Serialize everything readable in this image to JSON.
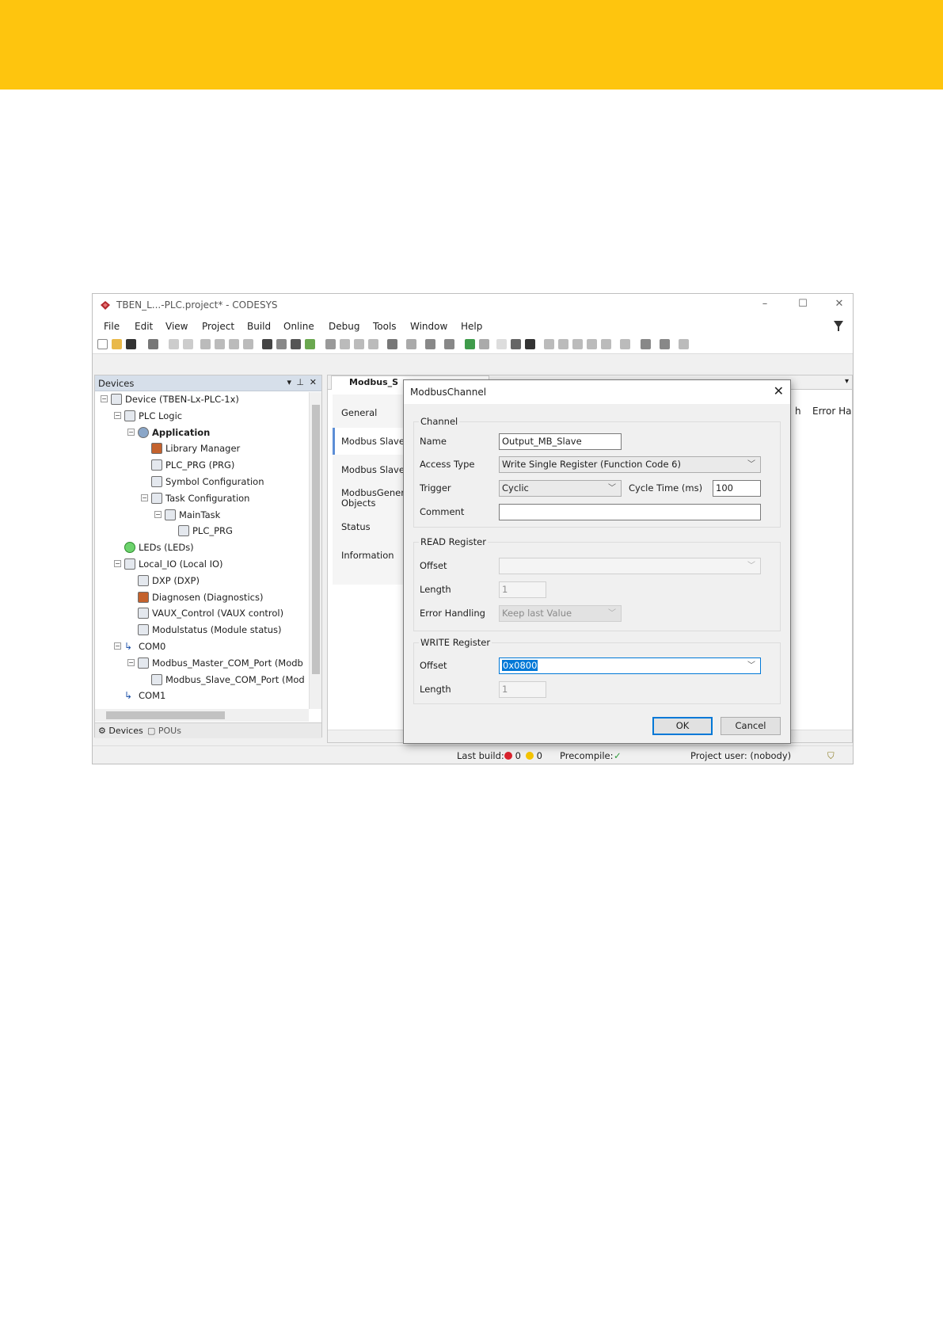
{
  "window": {
    "title": "TBEN_L...-PLC.project* - CODESYS"
  },
  "menu": [
    "File",
    "Edit",
    "View",
    "Project",
    "Build",
    "Online",
    "Debug",
    "Tools",
    "Window",
    "Help"
  ],
  "devices_panel": {
    "title": "Devices",
    "tree": [
      {
        "label": "Device (TBEN-Lx-PLC-1x)",
        "level": 0,
        "expand": "-"
      },
      {
        "label": "PLC Logic",
        "level": 1,
        "expand": "-"
      },
      {
        "label": "Application",
        "level": 2,
        "expand": "-",
        "bold": true
      },
      {
        "label": "Library Manager",
        "level": 3,
        "expand": ""
      },
      {
        "label": "PLC_PRG (PRG)",
        "level": 3,
        "expand": ""
      },
      {
        "label": "Symbol Configuration",
        "level": 3,
        "expand": ""
      },
      {
        "label": "Task Configuration",
        "level": 3,
        "expand": "-"
      },
      {
        "label": "MainTask",
        "level": 4,
        "expand": "-"
      },
      {
        "label": "PLC_PRG",
        "level": 5,
        "expand": ""
      },
      {
        "label": "LEDs (LEDs)",
        "level": 1,
        "expand": ""
      },
      {
        "label": "Local_IO (Local IO)",
        "level": 1,
        "expand": "-"
      },
      {
        "label": "DXP (DXP)",
        "level": 2,
        "expand": ""
      },
      {
        "label": "Diagnosen (Diagnostics)",
        "level": 2,
        "expand": ""
      },
      {
        "label": "VAUX_Control (VAUX control)",
        "level": 2,
        "expand": ""
      },
      {
        "label": "Modulstatus (Module status)",
        "level": 2,
        "expand": ""
      },
      {
        "label": "COM0",
        "level": 1,
        "expand": "-"
      },
      {
        "label": "Modbus_Master_COM_Port (Modb",
        "level": 2,
        "expand": "-"
      },
      {
        "label": "Modbus_Slave_COM_Port (Mod",
        "level": 3,
        "expand": ""
      },
      {
        "label": "COM1",
        "level": 1,
        "expand": ""
      }
    ],
    "tabs": [
      "Devices",
      "POUs"
    ]
  },
  "editor": {
    "tab_title": "Modbus_S",
    "side_tabs": [
      "General",
      "Modbus Slave C",
      "Modbus Slave I",
      "ModbusGeneric Objects",
      "Status",
      "Information"
    ],
    "right_col_1": "h",
    "right_col_2": "Error Ha"
  },
  "dialog": {
    "title": "ModbusChannel",
    "channel": {
      "group_label": "Channel",
      "name_label": "Name",
      "name_value": "Output_MB_Slave",
      "access_type_label": "Access Type",
      "access_type_value": "Write Single Register (Function Code 6)",
      "trigger_label": "Trigger",
      "trigger_value": "Cyclic",
      "cycle_time_label": "Cycle Time (ms)",
      "cycle_time_value": "100",
      "comment_label": "Comment",
      "comment_value": ""
    },
    "read_register": {
      "group_label": "READ Register",
      "offset_label": "Offset",
      "offset_value": "",
      "length_label": "Length",
      "length_value": "1",
      "error_handling_label": "Error Handling",
      "error_handling_value": "Keep last Value"
    },
    "write_register": {
      "group_label": "WRITE Register",
      "offset_label": "Offset",
      "offset_value": "0x0800",
      "length_label": "Length",
      "length_value": "1"
    },
    "ok_label": "OK",
    "cancel_label": "Cancel"
  },
  "statusbar": {
    "last_build_label": "Last build:",
    "errors": "0",
    "warnings": "0",
    "precompile_label": "Precompile:",
    "project_user": "Project user: (nobody)"
  },
  "colors": {
    "banner": "#fec50e",
    "accent": "#0078d7",
    "error": "#d9232e",
    "warning": "#f5c400",
    "ok": "#2e9b3a"
  }
}
